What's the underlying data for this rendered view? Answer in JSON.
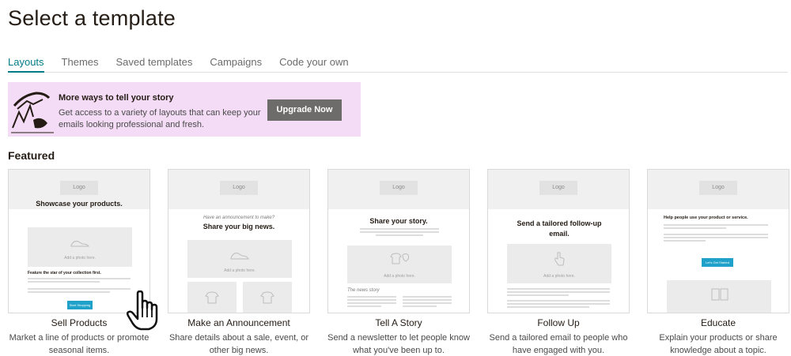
{
  "page": {
    "title": "Select a template"
  },
  "tabs": [
    {
      "label": "Layouts",
      "active": true
    },
    {
      "label": "Themes",
      "active": false
    },
    {
      "label": "Saved templates",
      "active": false
    },
    {
      "label": "Campaigns",
      "active": false
    },
    {
      "label": "Code your own",
      "active": false
    }
  ],
  "banner": {
    "title": "More ways to tell your story",
    "text": "Get access to a variety of layouts that can keep your emails looking professional and fresh.",
    "button": "Upgrade Now",
    "bg_color": "#f4dcf6"
  },
  "featured": {
    "title": "Featured",
    "cards": [
      {
        "label": "Sell Products",
        "description": "Market a line of products or promote seasonal items.",
        "preview": {
          "logo": "Logo",
          "headline": "Showcase your products.",
          "photo_label": "Add a photo here.",
          "subhead": "Feature the star of your collection first.",
          "button": "Start Shopping"
        }
      },
      {
        "label": "Make an Announcement",
        "description": "Share details about a sale, event, or other big news.",
        "preview": {
          "logo": "Logo",
          "kicker": "Have an announcement to make?",
          "headline": "Share your big news.",
          "photo_label": "Add a photo here."
        }
      },
      {
        "label": "Tell A Story",
        "description": "Send a newsletter to let people know what you've been up to.",
        "preview": {
          "logo": "Logo",
          "headline": "Share your story.",
          "photo_label": "Add a photo here.",
          "section": "The news story"
        }
      },
      {
        "label": "Follow Up",
        "description": "Send a tailored email to people who have engaged with you.",
        "preview": {
          "logo": "Logo",
          "headline": "Send a tailored follow-up email.",
          "photo_label": "Add a photo here."
        }
      },
      {
        "label": "Educate",
        "description": "Explain your products or share knowledge about a topic.",
        "preview": {
          "logo": "Logo",
          "headline": "Help people use your product or service.",
          "button": "Let's Get Started"
        }
      }
    ]
  },
  "colors": {
    "accent": "#007c89",
    "button_dark": "#6e6c6a",
    "mini_button": "#1fa1c9"
  }
}
